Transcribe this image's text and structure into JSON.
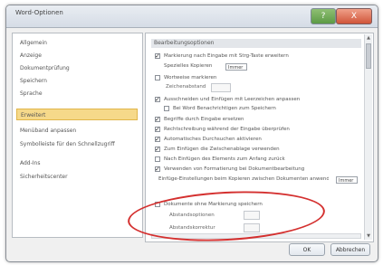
{
  "window": {
    "title": "Word-Optionen",
    "help_label": "?",
    "close_label": "X"
  },
  "nav": {
    "items": [
      {
        "label": "Allgemein"
      },
      {
        "label": "Anzeige"
      },
      {
        "label": "Dokumentprüfung"
      },
      {
        "label": "Speichern"
      },
      {
        "label": "Sprache"
      },
      {
        "label": "Erweitert"
      },
      {
        "label": "Menüband anpassen"
      },
      {
        "label": "Symbolleiste für den Schnellzugriff"
      },
      {
        "label": "Add-Ins"
      },
      {
        "label": "Sicherheitscenter"
      }
    ],
    "selected_index": 5
  },
  "content": {
    "section_title": "Bearbeitungsoptionen",
    "options": [
      {
        "label": "Markierung nach Eingabe mit Strg-Taste erweitern",
        "checked": true
      },
      {
        "label": "Wortweise markieren",
        "checked": false
      },
      {
        "label": "Ausschneiden und Einfügen mit Leerzeichen anpassen",
        "checked": true
      },
      {
        "label": "Bei Word Benachrichtigen zum Speichern",
        "checked": false
      },
      {
        "label": "Begriffe durch Eingabe ersetzen",
        "checked": true
      },
      {
        "label": "Rechtschreibung während der Eingabe überprüfen",
        "checked": true
      },
      {
        "label": "Automatisches Durchsuchen aktivieren",
        "checked": true
      },
      {
        "label": "Zum Einfügen die Zwischenablage verwenden",
        "checked": true
      },
      {
        "label": "Nach Einfügen des Elements zum Anfang zurück",
        "checked": false
      },
      {
        "label": "Verwenden von Formatierung bei Dokumentbearbeitung",
        "checked": true
      }
    ],
    "inline_option": {
      "label": "Spezielles Kopieren",
      "select_value": "Immer"
    },
    "disabled_row_label": "Zeichenabstand",
    "long_row": {
      "label": "Einfüge-Einstellungen beim Kopieren zwischen Dokumenten anwenden",
      "select_value": "Immer"
    },
    "highlighted": {
      "checkbox_label": "Dokumente ohne Markierung speichern",
      "field1_label": "Abstandsoptionen",
      "field2_label": "Abstandskorrektur"
    }
  },
  "footer": {
    "ok_label": "OK",
    "cancel_label": "Abbrechen"
  },
  "colors": {
    "selected_nav_bg": "#f6d98a",
    "annotation_ellipse": "#d4302f"
  }
}
